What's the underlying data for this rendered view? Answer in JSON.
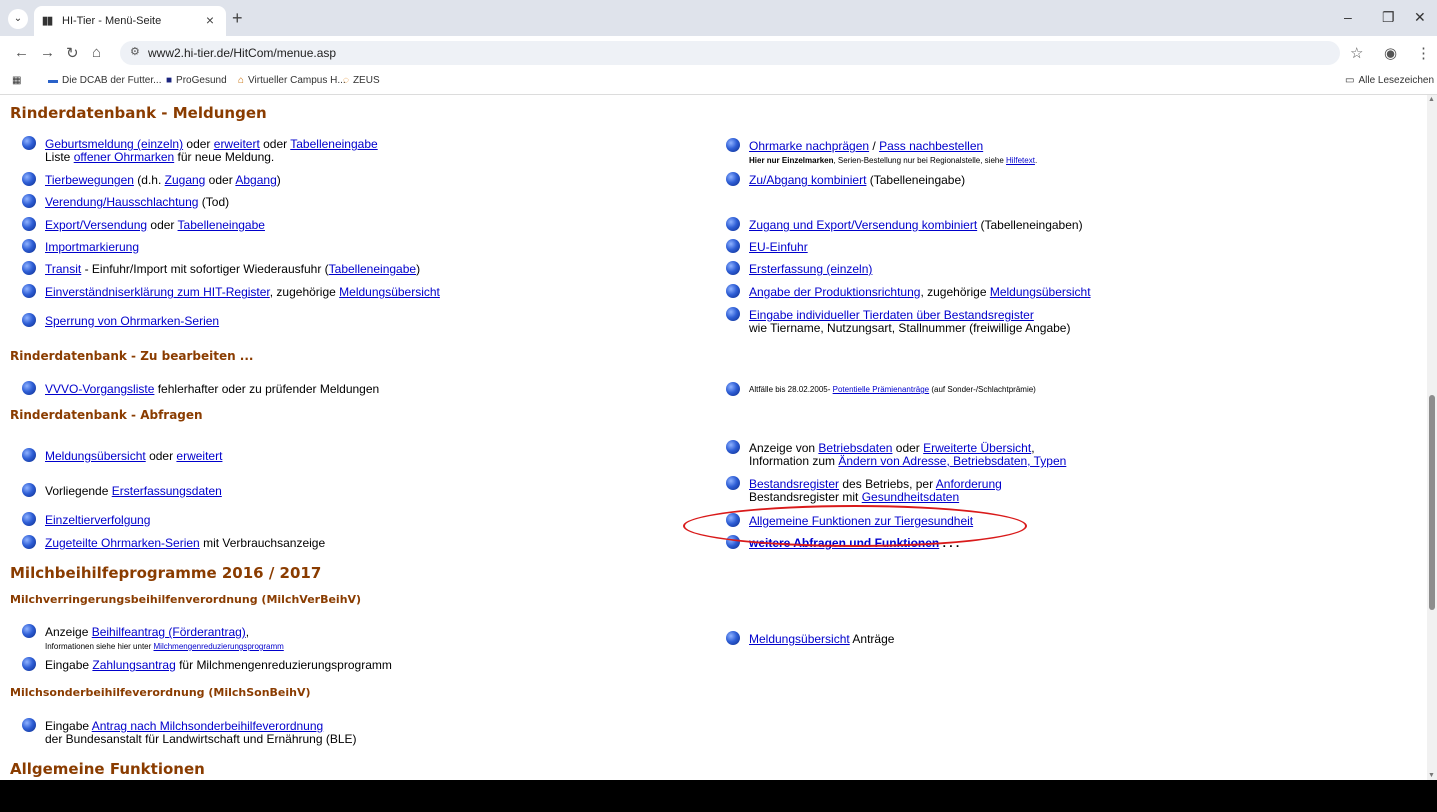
{
  "browser": {
    "tab_title": "HI-Tier - Menü-Seite",
    "url": "www2.hi-tier.de/HitCom/menue.asp",
    "bookmarks": [
      "Die DCAB der Futter...",
      "ProGesund",
      "Virtueller Campus H...",
      "ZEUS"
    ],
    "all_bookmarks": "Alle Lesezeichen"
  },
  "sections": {
    "meldungen": "Rinderdatenbank - Meldungen",
    "zu_bearbeiten": "Rinderdatenbank - Zu bearbeiten ...",
    "abfragen": "Rinderdatenbank - Abfragen",
    "milch": "Milchbeihilfeprogramme 2016 / 2017",
    "milchver": "Milchverringerungsbeihilfenverordnung (MilchVerBeihV)",
    "milchson": "Milchsonderbeihilfeverordnung (MilchSonBeihV)",
    "allgemein": "Allgemeine Funktionen"
  },
  "left": {
    "geburt": {
      "l1": "Geburtsmeldung (einzeln)",
      "t1": " oder ",
      "l2": "erweitert",
      "t2": " oder ",
      "l3": "Tabelleneingabe",
      "s1": "Liste ",
      "s2": "offener Ohrmarken",
      "s3": " für neue Meldung."
    },
    "tierbew": {
      "l1": "Tierbewegungen",
      "t1": " (d.h. ",
      "l2": "Zugang",
      "t2": " oder ",
      "l3": "Abgang",
      "t3": ")"
    },
    "verendung": {
      "l1": "Verendung/Hausschlachtung",
      "t1": " (Tod)"
    },
    "export": {
      "l1": "Export/Versendung",
      "t1": " oder ",
      "l2": "Tabelleneingabe"
    },
    "import": {
      "l1": "Importmarkierung"
    },
    "transit": {
      "l1": "Transit",
      "t1": " - Einfuhr/Import mit sofortiger Wiederausfuhr (",
      "l2": "Tabelleneingabe",
      "t2": ")"
    },
    "einverst": {
      "l1": "Einverständniserklärung zum HIT-Register",
      "t1": ", zugehörige ",
      "l2": "Meldungsübersicht"
    },
    "sperrung": {
      "l1": "Sperrung von Ohrmarken-Serien"
    },
    "vvvo": {
      "l1": "VVVO-Vorgangsliste",
      "t1": " fehlerhafter oder zu prüfender Meldungen"
    },
    "meldueb": {
      "l1": "Meldungsübersicht",
      "t1": " oder ",
      "l2": "erweitert"
    },
    "vorlieg": {
      "t1": "Vorliegende ",
      "l1": "Ersterfassungsdaten"
    },
    "einzeltier": {
      "l1": "Einzeltierverfolgung"
    },
    "zugeteilt": {
      "l1": "Zugeteilte Ohrmarken-Serien",
      "t1": " mit Verbrauchsanzeige"
    },
    "beihilfe": {
      "t1": "Anzeige ",
      "l1": "Beihilfeantrag (Förderantrag)",
      "t2": ",",
      "s1": "Informationen siehe hier unter ",
      "s2": "Milchmengenreduzierungsprogramm"
    },
    "zahlung": {
      "t1": "Eingabe ",
      "l1": "Zahlungsantrag",
      "t2": " für Milchmengenreduzierungsprogramm"
    },
    "sonder": {
      "t1": "Eingabe ",
      "l1": "Antrag nach Milchsonderbeihilfeverordnung",
      "s1": "der Bundesanstalt für Landwirtschaft und Ernährung (BLE)"
    }
  },
  "right": {
    "ohrmarke": {
      "l1": "Ohrmarke nachprägen",
      "t1": " / ",
      "l2": "Pass nachbestellen",
      "s1": "Hier nur Einzelmarken",
      "s2": ", Serien-Bestellung nur bei Regionalstelle, siehe ",
      "s3": "Hilfetext",
      "s4": "."
    },
    "zuab": {
      "l1": "Zu/Abgang kombiniert",
      "t1": " (Tabelleneingabe)"
    },
    "zugexp": {
      "l1": "Zugang und Export/Versendung kombiniert",
      "t1": " (Tabelleneingaben)"
    },
    "eu": {
      "l1": "EU-Einfuhr"
    },
    "erst": {
      "l1": "Ersterfassung (einzeln)"
    },
    "produktion": {
      "l1": "Angabe der Produktionsrichtung",
      "t1": ", zugehörige ",
      "l2": "Meldungsübersicht"
    },
    "tierdaten": {
      "l1": "Eingabe individueller Tierdaten über Bestandsregister",
      "s1": "wie Tiername, Nutzungsart, Stallnummer (freiwillige Angabe)"
    },
    "altfaelle": {
      "t1": "Altfälle bis 28.02.2005- ",
      "l1": "Potentielle Prämienanträge",
      "t2": " (auf Sonder-/Schlachtprämie)"
    },
    "betrieb": {
      "t1": "Anzeige von ",
      "l1": "Betriebsdaten",
      "t2": " oder ",
      "l2": "Erweiterte Übersicht",
      "t3": ",",
      "s1": "Information zum ",
      "s2": "Ändern von Adresse, Betriebsdaten, Typen"
    },
    "bestand": {
      "l1": "Bestandsregister",
      "t1": " des Betriebs, per ",
      "l2": "Anforderung",
      "s1": "Bestandsregister mit ",
      "s2": "Gesundheitsdaten"
    },
    "allgfunk": {
      "l1": "Allgemeine Funktionen zur Tiergesundheit"
    },
    "weitere": {
      "l1": "weitere Abfragen und Funktionen",
      "t1": " . . ."
    },
    "antraege": {
      "l1": "Meldungsübersicht",
      "t1": " Anträge"
    }
  }
}
